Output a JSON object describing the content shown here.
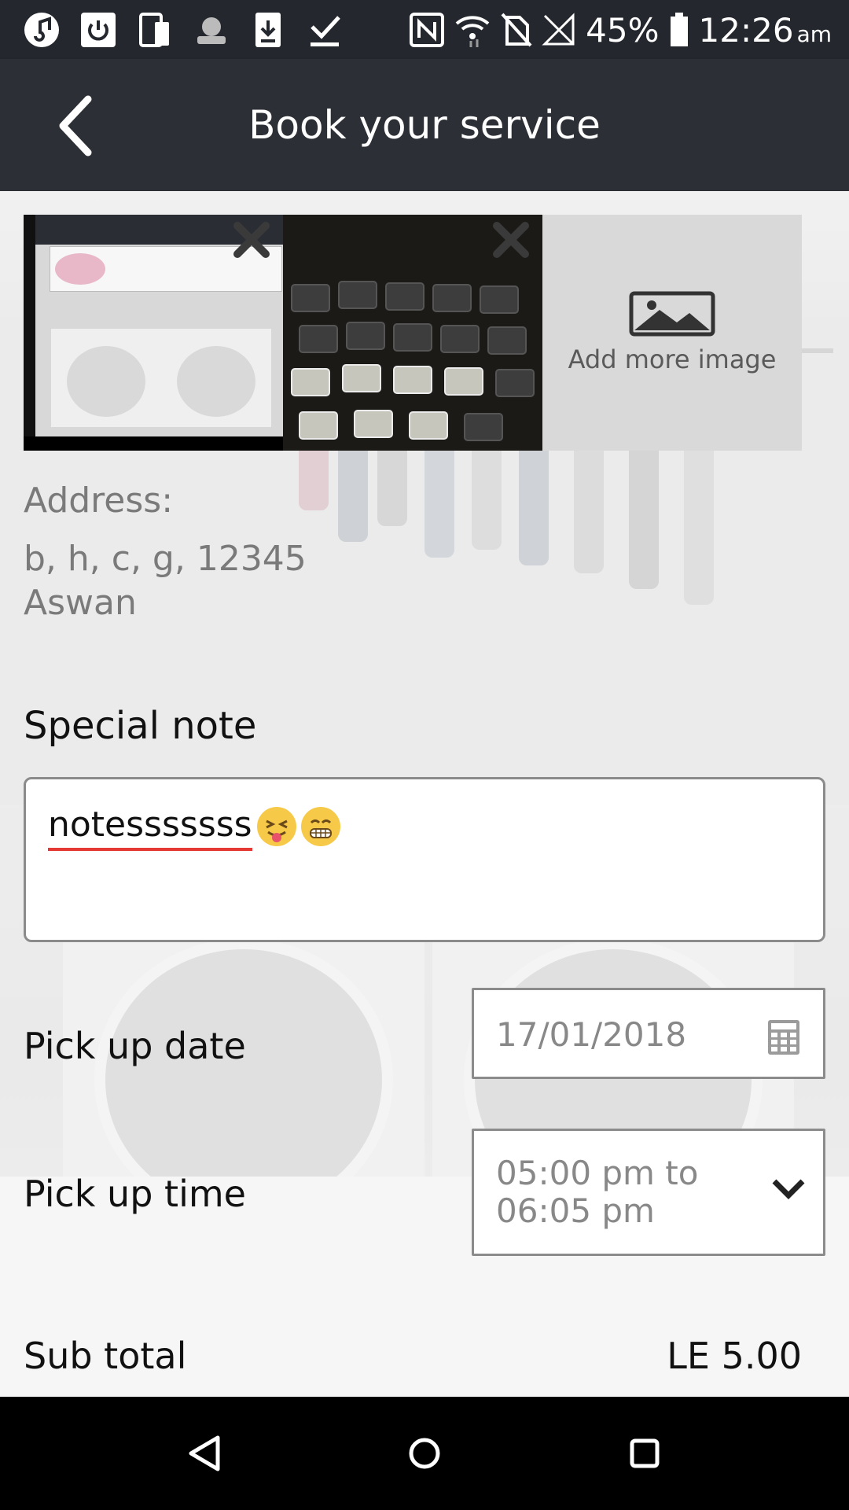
{
  "status_bar": {
    "battery": "45%",
    "time": "12:26",
    "time_suffix": "am"
  },
  "app_bar": {
    "title": "Book your service"
  },
  "images": {
    "add_more_label": "Add more image"
  },
  "address": {
    "label": "Address:",
    "line1": "b, h, c, g, 12345",
    "line2": "Aswan"
  },
  "special_note": {
    "label": "Special note",
    "value": "notesssssss"
  },
  "pickup_date": {
    "label": "Pick up date",
    "value": "17/01/2018"
  },
  "pickup_time": {
    "label": "Pick up time",
    "value": "05:00 pm to 06:05 pm"
  },
  "subtotal": {
    "label": "Sub total",
    "value": "LE 5.00"
  },
  "colors": {
    "status_bar": "#24272e",
    "app_bar": "#2c2f35",
    "spellcheck": "#e53935",
    "field_border": "#8b8b8b"
  }
}
